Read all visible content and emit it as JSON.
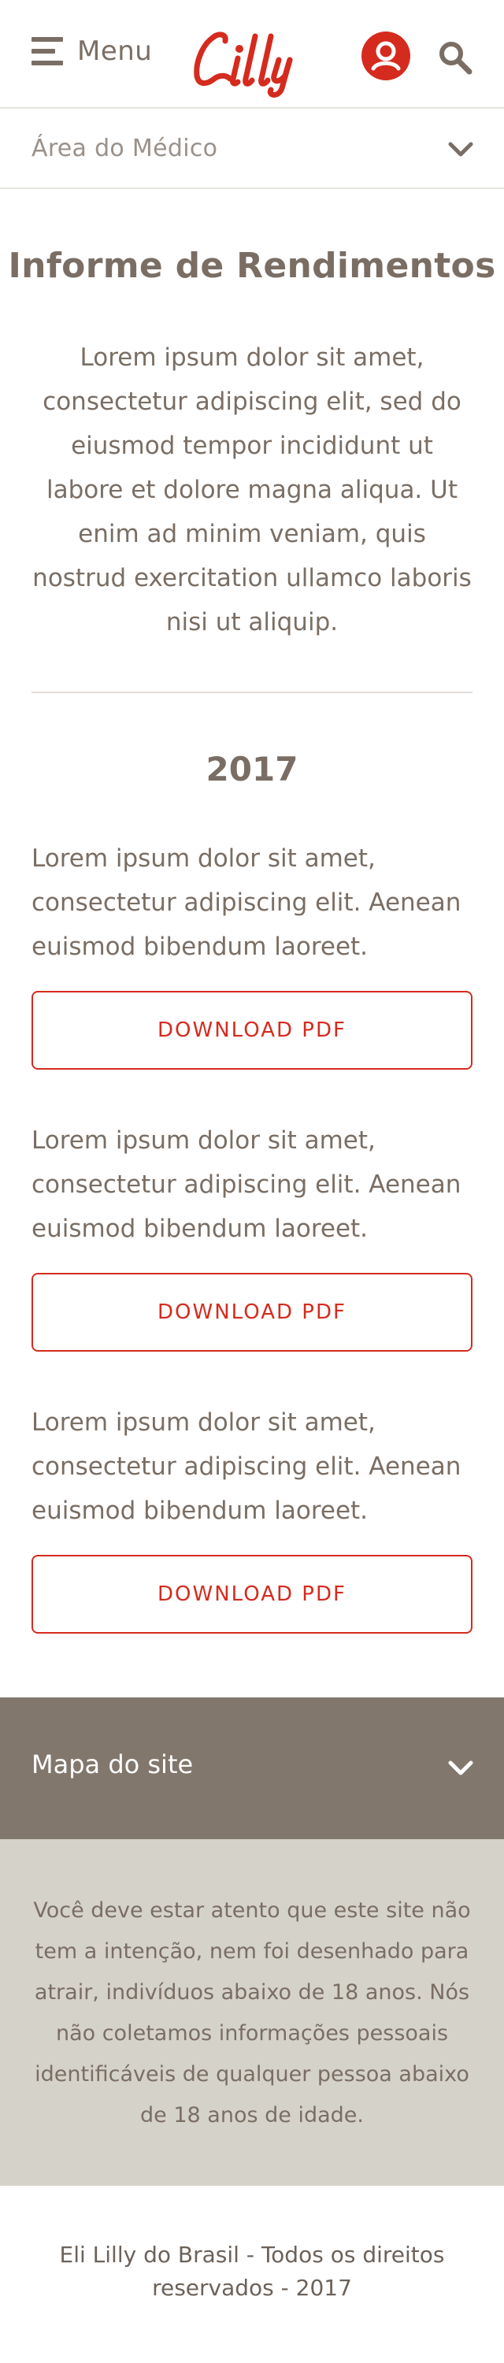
{
  "header": {
    "menu_label": "Menu",
    "logo_text": "Lilly",
    "brand_color": "#d52b1e",
    "icons": [
      "hamburger-menu-icon",
      "user-icon",
      "search-icon"
    ]
  },
  "section_selector": {
    "label": "Área do Médico",
    "icon": "chevron-down-icon"
  },
  "intro": {
    "title": "Informe de Rendimentos",
    "text": "Lorem ipsum dolor sit amet, consectetur adipiscing elit, sed do eiusmod tempor incididunt ut labore et dolore magna aliqua. Ut enim ad minim veniam, quis nostrud exercitation ullamco laboris nisi ut aliquip."
  },
  "reports": {
    "year": "2017",
    "items": [
      {
        "text": "Lorem ipsum dolor sit amet, consectetur adipiscing elit. Aenean euismod bibendum laoreet.",
        "button_label": "DOWNLOAD PDF"
      },
      {
        "text": "Lorem ipsum dolor sit amet, consectetur adipiscing elit. Aenean euismod bibendum laoreet.",
        "button_label": "DOWNLOAD PDF"
      },
      {
        "text": "Lorem ipsum dolor sit amet, consectetur adipiscing elit. Aenean euismod bibendum laoreet.",
        "button_label": "DOWNLOAD PDF"
      }
    ]
  },
  "footer": {
    "sitemap_label": "Mapa do site",
    "sitemap_icon": "chevron-down-icon",
    "disclaimer": "Você deve estar atento que este site não tem a intenção, nem foi desenhado para atrair, indivíduos abaixo de 18 anos. Nós não coletamos informações pessoais identificáveis de qualquer pessoa abaixo de 18 anos de idade.",
    "copyright": "Eli Lilly do Brasil - Todos os direitos reservados - 2017"
  }
}
